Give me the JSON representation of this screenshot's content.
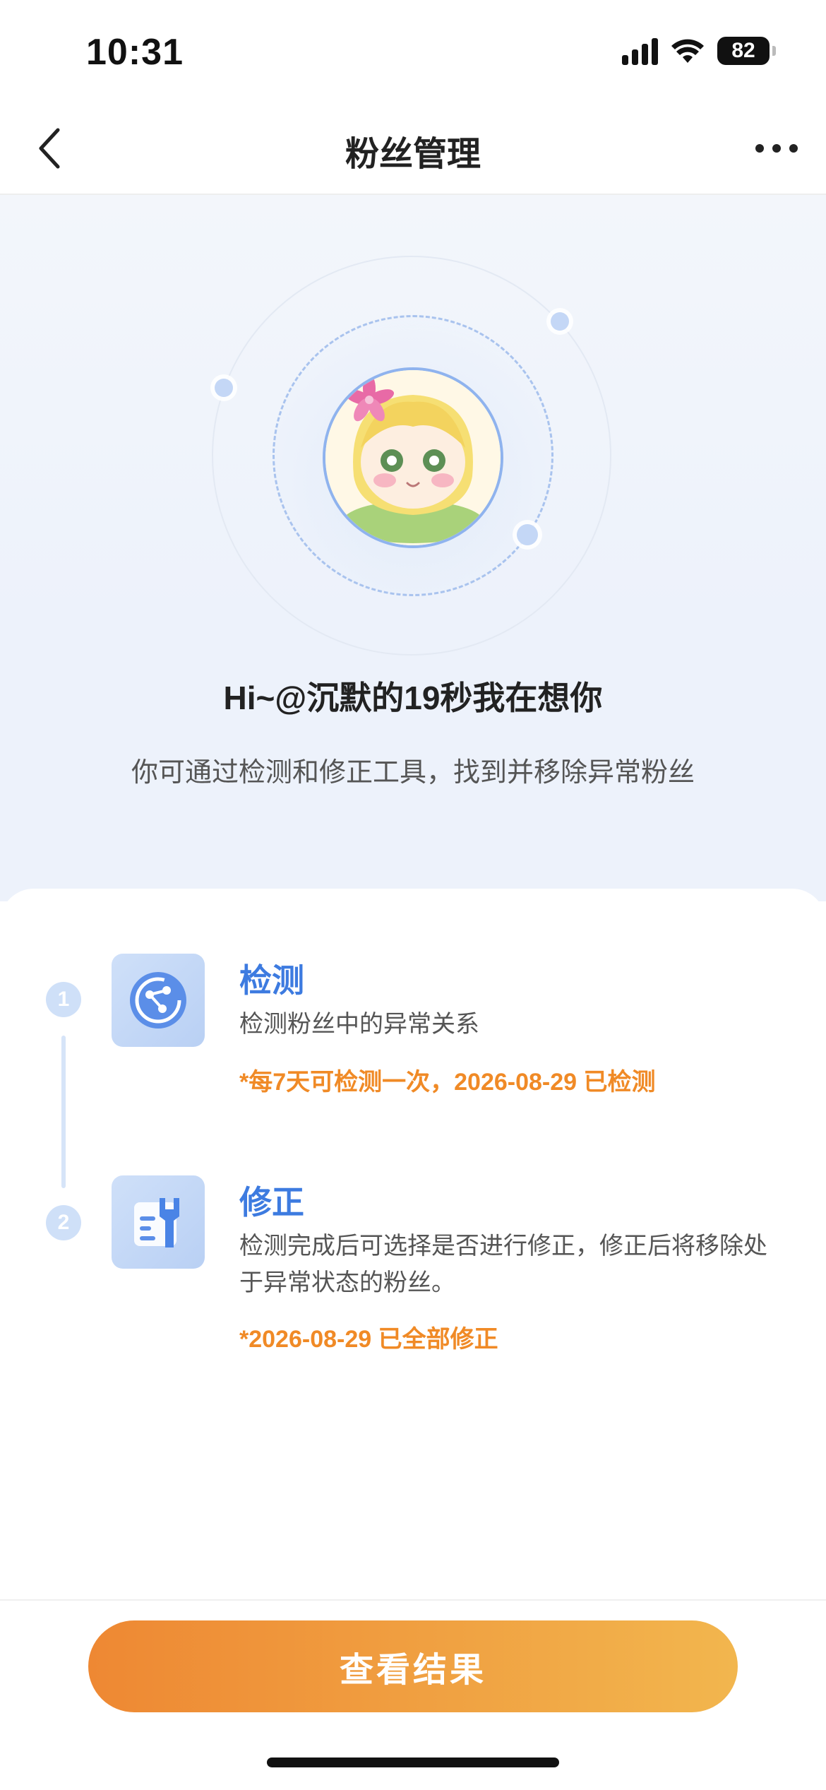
{
  "status_bar": {
    "time": "10:31",
    "battery": "82"
  },
  "nav": {
    "title": "粉丝管理"
  },
  "hero": {
    "greeting": "Hi~@沉默的19秒我在想你",
    "subtitle": "你可通过检测和修正工具，找到并移除异常粉丝"
  },
  "steps": [
    {
      "number": "1",
      "title": "检测",
      "description": "检测粉丝中的异常关系",
      "note": "*每7天可检测一次，2026-08-29 已检测",
      "icon": "detect-icon"
    },
    {
      "number": "2",
      "title": "修正",
      "description": "检测完成后可选择是否进行修正，修正后将移除处于异常状态的粉丝。",
      "note": "*2026-08-29 已全部修正",
      "icon": "wrench-icon"
    }
  ],
  "cta": {
    "label": "查看结果"
  },
  "colors": {
    "accent_blue": "#3d7be0",
    "accent_orange": "#f08a26",
    "cta_start": "#ee8833",
    "cta_end": "#f2b64e"
  }
}
